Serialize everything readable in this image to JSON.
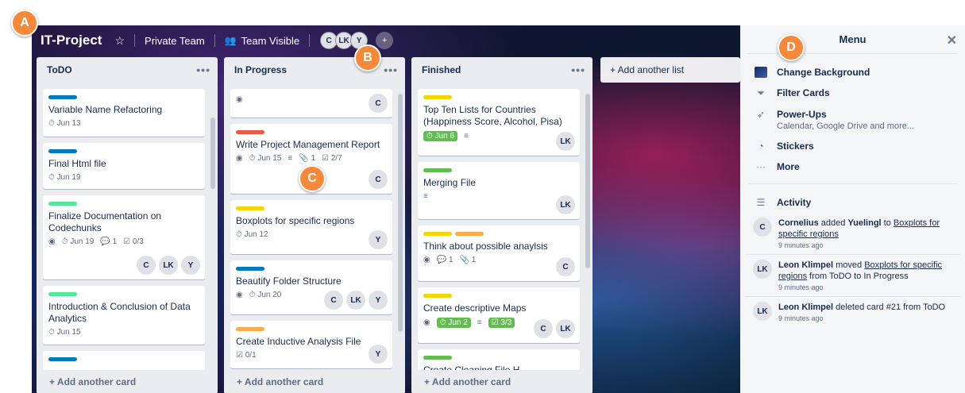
{
  "board": {
    "title": "IT-Project",
    "team": "Private Team",
    "visibility": "Team Visible",
    "members": [
      "C",
      "LK",
      "Y"
    ]
  },
  "lists": [
    {
      "title": "ToDO",
      "add_card": "+ Add another card",
      "cards": [
        {
          "title": "Variable Name Refactoring",
          "label_color": "#0079bf",
          "due": "Jun 13",
          "members": []
        },
        {
          "title": "Final Html file",
          "label_color": "#0079bf",
          "due": "Jun 19",
          "members": []
        },
        {
          "title": "Finalize Documentation on Codechunks",
          "label_color": "#51e898",
          "due": "Jun 19",
          "comments": "1",
          "checklist": "0/3",
          "members": [
            "C",
            "LK",
            "Y"
          ]
        },
        {
          "title": "Introduction & Conclusion of Data Analytics",
          "label_color": "#51e898",
          "due": "Jun 15",
          "members": []
        }
      ]
    },
    {
      "title": "In Progress",
      "add_card": "+ Add another card",
      "cards": [
        {
          "title": "",
          "members": [
            "C"
          ]
        },
        {
          "title": "Write Project Management Report",
          "label_color": "#eb5a46",
          "due": "Jun 15",
          "attachments": "1",
          "checklist": "2/7",
          "members": [
            "C"
          ]
        },
        {
          "title": "Boxplots for specific regions",
          "label_color": "#f2d600",
          "due": "Jun 12",
          "members": [
            "Y"
          ]
        },
        {
          "title": "Beautify Folder Structure",
          "label_color": "#0079bf",
          "due": "Jun 20",
          "members": [
            "C",
            "LK",
            "Y"
          ]
        },
        {
          "title": "Create Inductive Analysis File",
          "label_color": "#ffab4a",
          "checklist": "0/1",
          "members": [
            "Y"
          ]
        }
      ]
    },
    {
      "title": "Finished",
      "add_card": "+ Add another card",
      "cards": [
        {
          "title": "Top Ten Lists for Countries (Happiness Score, Alcohol, Pisa)",
          "label_color": "#f2d600",
          "due": "Jun 6",
          "members": [
            "LK"
          ]
        },
        {
          "title": "Merging File",
          "label_color": "#61bd4f",
          "members": [
            "LK"
          ]
        },
        {
          "title": "Think about possible anaylsis",
          "label_color": "#f2d600",
          "label2_color": "#ffab4a",
          "comments": "1",
          "attachments": "1",
          "members": [
            "C"
          ]
        },
        {
          "title": "Create descriptive Maps",
          "label_color": "#f2d600",
          "due": "Jun 2",
          "checklist": "3/3",
          "members": [
            "C",
            "LK"
          ]
        },
        {
          "title": "Create Cleaning File H...",
          "label_color": "#61bd4f",
          "members": []
        }
      ]
    }
  ],
  "add_list": "+ Add another list",
  "menu": {
    "title": "Menu",
    "items": [
      {
        "label": "Change Background",
        "icon": "background-thumb-icon"
      },
      {
        "label": "Filter Cards",
        "icon": "filter-icon"
      },
      {
        "label": "Power-Ups",
        "sub": "Calendar, Google Drive and more...",
        "icon": "rocket-icon"
      },
      {
        "label": "Stickers",
        "icon": "sticker-icon"
      },
      {
        "label": "More",
        "icon": "more-icon"
      }
    ],
    "activity_title": "Activity",
    "activity": [
      {
        "avatar": "C",
        "actor": "Cornelius",
        "time": "9 minutes ago"
      },
      {
        "avatar": "LK",
        "actor": "Leon Klimpel",
        "time": "9 minutes ago"
      },
      {
        "avatar": "LK",
        "actor": "Leon Klimpel",
        "time": "9 minutes ago"
      }
    ],
    "activity_texts": {
      "a1_mid": " added ",
      "a1_target": "Yuelingl",
      "a1_to": " to ",
      "a1_card": "Boxplots for specific regions",
      "a2_mid": " moved ",
      "a2_card": "Boxplots for specific regions",
      "a2_rest": " from ToDO to In Progress",
      "a3_rest": " deleted card #21 from ToDO"
    }
  },
  "markers": [
    "A",
    "B",
    "C",
    "D"
  ]
}
